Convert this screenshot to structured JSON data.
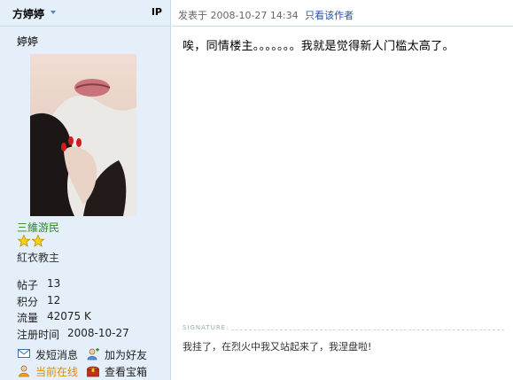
{
  "user": {
    "name": "方婷婷",
    "ip_label": "IP",
    "nickname": "婷婷",
    "rank": "三維游民",
    "title": "紅衣教主",
    "stats": [
      {
        "label": "帖子",
        "value": "13"
      },
      {
        "label": "积分",
        "value": "12"
      },
      {
        "label": "流量",
        "value": "42075 K"
      },
      {
        "label": "注册时间",
        "value": "2008-10-27"
      }
    ],
    "actions": {
      "message": "发短消息",
      "add_friend": "加为好友",
      "online": "当前在线",
      "treasure": "查看宝箱"
    }
  },
  "post": {
    "meta_prefix": "发表于",
    "datetime": "2008-10-27 14:34",
    "only_author": "只看该作者",
    "content": "唉，同情楼主。。。。。。。我就是觉得新人门槛太高了。",
    "signature_label": "SIGNATURE:",
    "signature": "我挂了，在烈火中我又站起来了，我涅盘啦!"
  },
  "colors": {
    "panel_bg": "#e5effa",
    "link": "#2255aa",
    "rank": "#2a8a1a",
    "online": "#e08a00"
  }
}
